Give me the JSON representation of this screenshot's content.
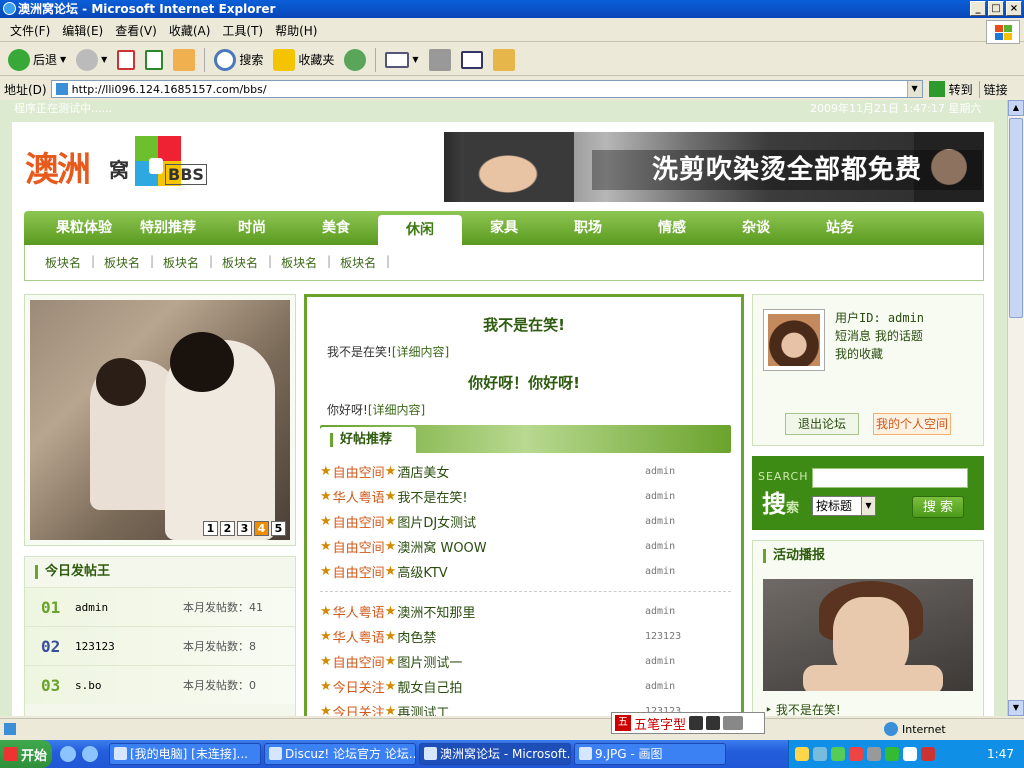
{
  "window": {
    "title": "澳洲窝论坛 - Microsoft Internet Explorer"
  },
  "menu": [
    "文件(F)",
    "编辑(E)",
    "查看(V)",
    "收藏(A)",
    "工具(T)",
    "帮助(H)"
  ],
  "toolbar": {
    "back": "后退",
    "search": "搜索",
    "favorites": "收藏夹"
  },
  "address": {
    "label": "地址(D)",
    "url": "http://lli096.124.1685157.com/bbs/",
    "go": "转到",
    "links": "链接"
  },
  "page": {
    "note": "程序正在测试中......",
    "date": "2009年11月21日 1:47:17 星期六",
    "logo": {
      "text": "澳洲",
      "sub": "窝",
      "bbs": "BBS"
    },
    "banner": "洗剪吹染烫全部都免费",
    "nav": [
      "果粒体验",
      "特别推荐",
      "时尚",
      "美食",
      "休闲",
      "家具",
      "职场",
      "情感",
      "杂谈",
      "站务"
    ],
    "subnav": [
      "板块名",
      "板块名",
      "板块名",
      "板块名",
      "板块名",
      "板块名"
    ],
    "slider_pages": [
      "1",
      "2",
      "3",
      "4",
      "5"
    ],
    "poster": {
      "title": "今日发帖王",
      "rows": [
        {
          "rank": "01",
          "name": "admin",
          "count": "本月发帖数：41"
        },
        {
          "rank": "02",
          "name": "123123",
          "count": "本月发帖数：8"
        },
        {
          "rank": "03",
          "name": "s.bo",
          "count": "本月发帖数：0"
        }
      ]
    },
    "headline1": {
      "title": "我不是在笑!",
      "desc": "我不是在笑!",
      "link": "[详细内容]"
    },
    "headline2": {
      "title": "你好呀！你好呀!",
      "desc": "你好呀!",
      "link": "[详细内容]"
    },
    "good_title": "好帖推荐",
    "good_posts_a": [
      {
        "cat": "自由空间",
        "title": "酒店美女",
        "author": "admin"
      },
      {
        "cat": "华人粤语",
        "title": "我不是在笑!",
        "author": "admin"
      },
      {
        "cat": "自由空间",
        "title": "图片DJ女测试",
        "author": "admin"
      },
      {
        "cat": "自由空间",
        "title": "澳洲窝 WOOW",
        "author": "admin"
      },
      {
        "cat": "自由空间",
        "title": "高级KTV",
        "author": "admin"
      }
    ],
    "good_posts_b": [
      {
        "cat": "华人粤语",
        "title": "澳洲不知那里",
        "author": "admin"
      },
      {
        "cat": "华人粤语",
        "title": "肉色禁",
        "author": "123123"
      },
      {
        "cat": "自由空间",
        "title": "图片测试一",
        "author": "admin"
      },
      {
        "cat": "今日关注",
        "title": "靓女自己拍",
        "author": "admin"
      },
      {
        "cat": "今日关注",
        "title": "再测试工",
        "author": "123123"
      }
    ],
    "user": {
      "id": "用户ID: admin",
      "pm": "短消息",
      "topics": "我的话题",
      "favs": "我的收藏",
      "logout": "退出论坛",
      "space": "我的个人空间"
    },
    "search": {
      "label": "SEARCH",
      "big": "搜",
      "small": "索",
      "select": "按标题",
      "button": "搜 索"
    },
    "activity": {
      "title": "活动播报",
      "caption": "我不是在笑!"
    }
  },
  "status": {
    "zone": "Internet"
  },
  "ime": {
    "label": "五笔字型"
  },
  "taskbar": {
    "start": "开始",
    "tasks": [
      "[我的电脑] [未连接]...",
      "Discuz! 论坛官方 论坛...",
      "澳洲窝论坛 - Microsoft...",
      "9.JPG - 画图"
    ],
    "clock": "1:47"
  }
}
